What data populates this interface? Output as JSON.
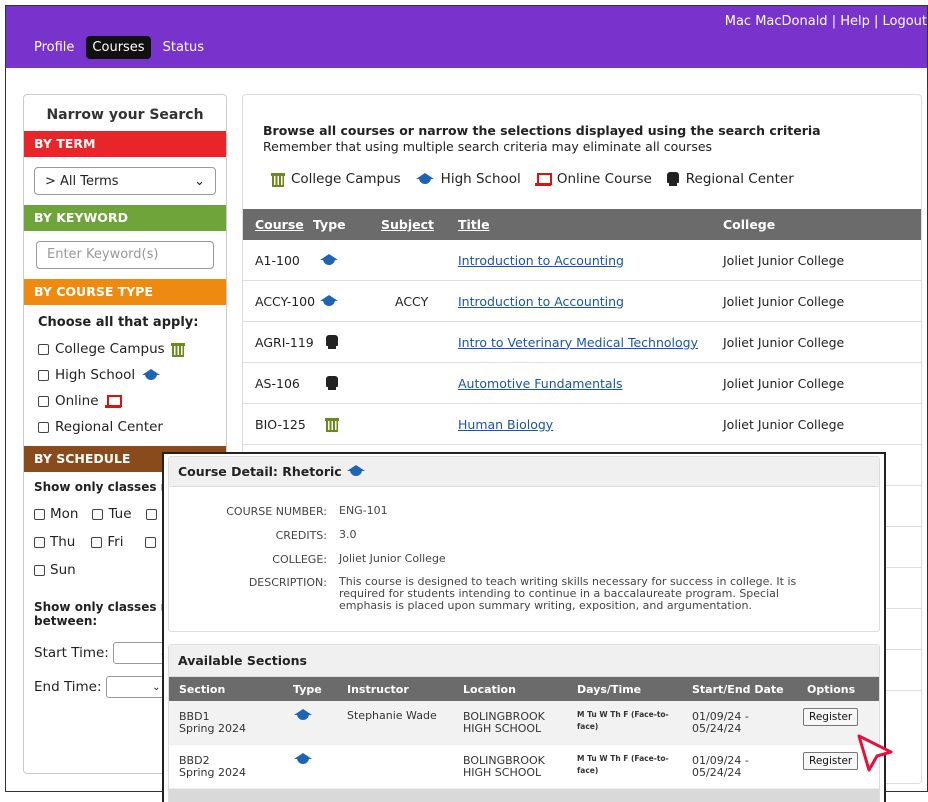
{
  "header": {
    "nav": [
      "Profile",
      "Courses",
      "Status"
    ],
    "active_nav": "Courses",
    "user_links": "Mac MacDonald | Help | Logout"
  },
  "sidebar": {
    "title": "Narrow your Search",
    "term": {
      "heading": "BY TERM",
      "selected": "> All Terms",
      "color": "#e8262a"
    },
    "keyword": {
      "heading": "BY KEYWORD",
      "placeholder": "Enter Keyword(s)",
      "color": "#6fa43a"
    },
    "course_type": {
      "heading": "BY COURSE TYPE",
      "color": "#ee8a10",
      "prompt": "Choose all that apply:",
      "options": [
        "College Campus",
        "High School",
        "Online",
        "Regional Center"
      ]
    },
    "schedule": {
      "heading": "BY SCHEDULE",
      "color": "#8a4b1c",
      "days_prompt": "Show only classes me",
      "days_row1": [
        "Mon",
        "Tue"
      ],
      "days_row2": [
        "Thu",
        "Fri"
      ],
      "days_row3": [
        "Sun"
      ],
      "time_prompt": "Show only classes me",
      "time_prompt2": "between:",
      "start_label": "Start Time:",
      "end_label": "End Time:"
    }
  },
  "main": {
    "intro_bold": "Browse all courses or narrow the selections displayed using the search criteria",
    "intro_note": "Remember that using multiple search criteria may eliminate all courses",
    "legend": [
      "College Campus",
      "High School",
      "Online Course",
      "Regional Center"
    ],
    "columns": [
      "Course",
      "Type",
      "Subject",
      "Title",
      "College"
    ],
    "rows": [
      {
        "course": "A1-100",
        "type": "high-school",
        "subject": "",
        "title": "Introduction to Accounting",
        "college": "Joliet Junior College"
      },
      {
        "course": "ACCY-100",
        "type": "high-school",
        "subject": "ACCY",
        "title": "Introduction to Accounting",
        "college": "Joliet Junior College"
      },
      {
        "course": "AGRI-119",
        "type": "regional-center",
        "subject": "",
        "title": "Intro to Veterinary Medical Technology",
        "college": "Joliet Junior College"
      },
      {
        "course": "AS-106",
        "type": "regional-center",
        "subject": "",
        "title": "Automotive Fundamentals",
        "college": "Joliet Junior College"
      },
      {
        "course": "BIO-125",
        "type": "college-campus",
        "subject": "",
        "title": "Human Biology",
        "college": "Joliet Junior College"
      }
    ]
  },
  "modal": {
    "title": "Course Detail: Rhetoric",
    "fields": {
      "number_label": "COURSE NUMBER:",
      "number": "ENG-101",
      "credits_label": "CREDITS:",
      "credits": "3.0",
      "college_label": "COLLEGE:",
      "college": "Joliet Junior College",
      "description_label": "DESCRIPTION:",
      "description": "This course is designed to teach writing skills necessary for success in college. It is required for students intending to continue in a baccalaureate program. Special emphasis is placed upon summary writing, exposition, and argumentation."
    },
    "sections_title": "Available Sections",
    "section_columns": [
      "Section",
      "Type",
      "Instructor",
      "Location",
      "Days/Time",
      "Start/End Date",
      "Options"
    ],
    "sections": [
      {
        "section": "BBD1",
        "term": "Spring 2024",
        "instructor": "Stephanie Wade",
        "location1": "BOLINGBROOK",
        "location2": "HIGH SCHOOL",
        "days": "M Tu W Th F (Face-to-face)",
        "start": "01/09/24 -",
        "end": "05/24/24",
        "action": "Register"
      },
      {
        "section": "BBD2",
        "term": "Spring 2024",
        "instructor": "",
        "location1": "BOLINGBROOK",
        "location2": "HIGH SCHOOL",
        "days": "M Tu W Th F (Face-to-face)",
        "start": "01/09/24 -",
        "end": "05/24/24",
        "action": "Register"
      }
    ]
  }
}
